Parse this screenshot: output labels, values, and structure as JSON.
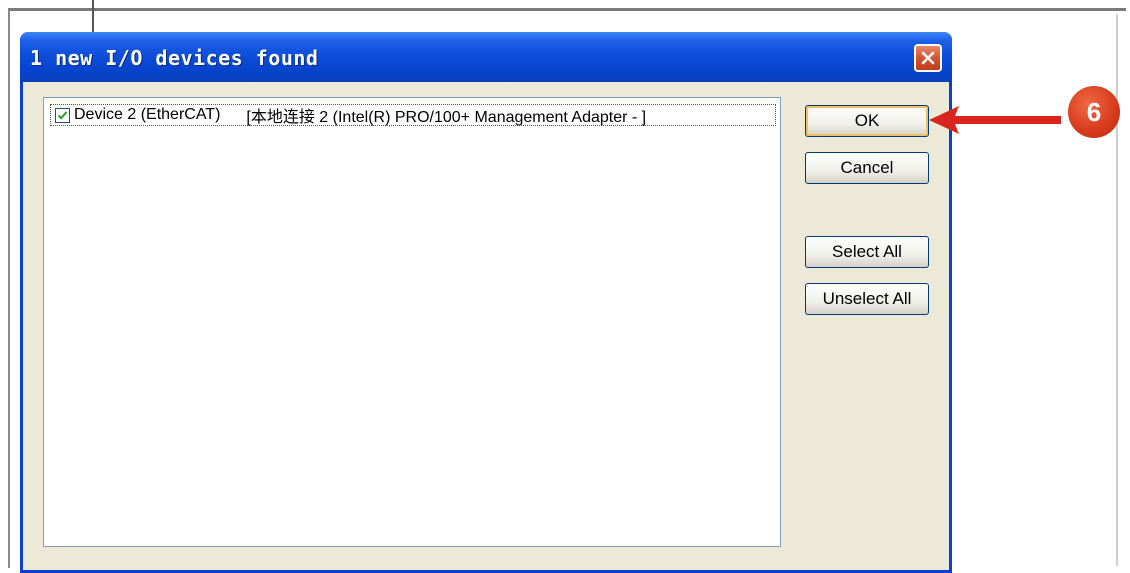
{
  "dialog": {
    "title": "1 new I/O devices found"
  },
  "device_list": {
    "items": [
      {
        "checked": true,
        "name": "Device 2 (EtherCAT)",
        "adapter": "[本地连接 2 (Intel(R) PRO/100+ Management Adapter - ]"
      }
    ]
  },
  "buttons": {
    "ok": "OK",
    "cancel": "Cancel",
    "select_all": "Select All",
    "unselect_all": "Unselect All"
  },
  "callout": {
    "step": "6",
    "color": "#d63a1a"
  },
  "colors": {
    "titlebar": "#0a4ad8",
    "dialog_bg": "#ece9d8",
    "button_border": "#003c74"
  }
}
